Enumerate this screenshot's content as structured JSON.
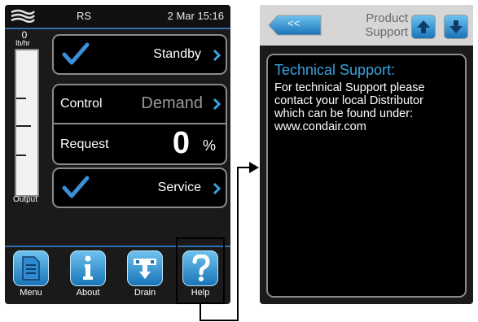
{
  "left_screen": {
    "status": {
      "model": "RS",
      "datetime": "2 Mar 15:16"
    },
    "gauge": {
      "value": "0",
      "unit": "lb/hr",
      "label": "Output",
      "level": 0
    },
    "standby": {
      "label": "Standby",
      "checked": true
    },
    "control": {
      "label": "Control",
      "value": "Demand"
    },
    "request": {
      "label": "Request",
      "value": "0",
      "unit": "%"
    },
    "service": {
      "label": "Service",
      "checked": true
    },
    "nav": [
      {
        "label": "Menu",
        "icon": "document-icon"
      },
      {
        "label": "About",
        "icon": "info-icon"
      },
      {
        "label": "Drain",
        "icon": "drain-icon"
      },
      {
        "label": "Help",
        "icon": "help-icon"
      }
    ]
  },
  "right_screen": {
    "back_label": "<<",
    "title": "Product\nSupport",
    "support_title": "Technical Support:",
    "support_body": "For technical Support please\ncontact your local Distributor\nwhich can be found under:\nwww.condair.com"
  },
  "colors": {
    "accent": "#3aa3e0",
    "tile_top": "#6cc2ee",
    "tile_bottom": "#1a74b8",
    "panel_border": "#8a8a8a"
  }
}
